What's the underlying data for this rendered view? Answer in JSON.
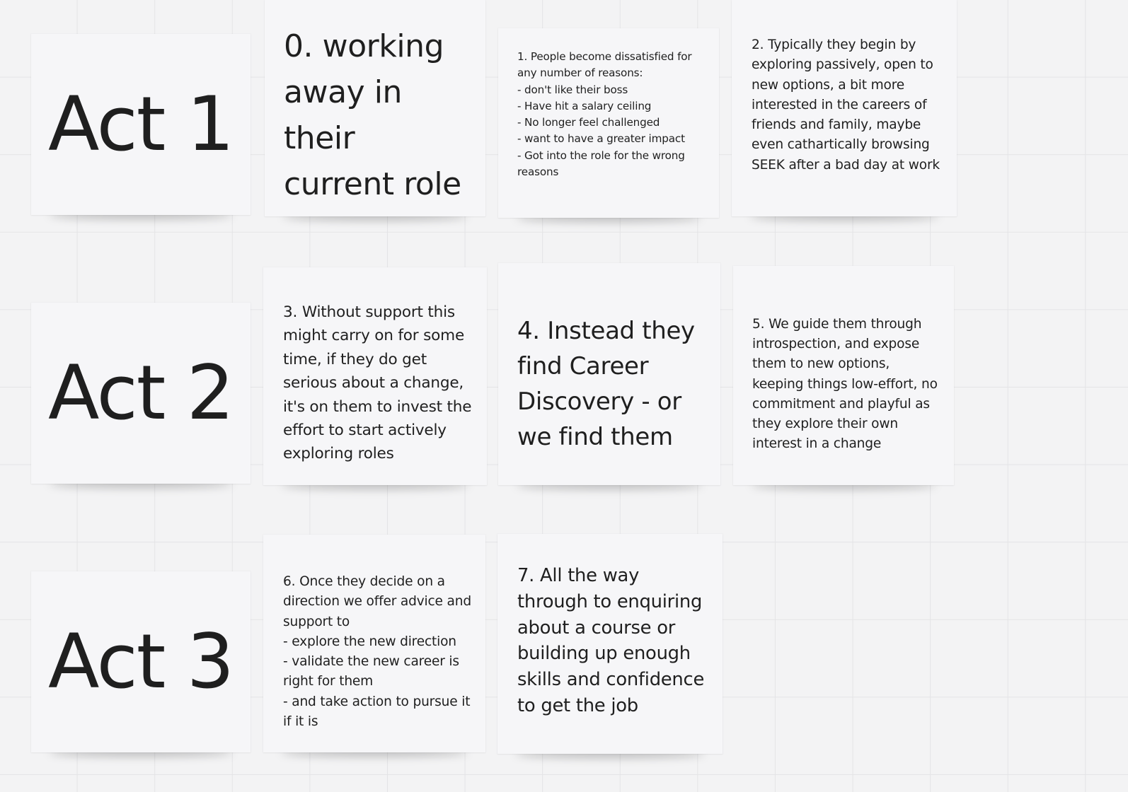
{
  "board": {
    "acts": [
      {
        "label": "Act 1"
      },
      {
        "label": "Act 2"
      },
      {
        "label": "Act 3"
      }
    ],
    "notes": [
      {
        "text": "0. working away in their current role"
      },
      {
        "text": "1. People become dissatisfied for any number of reasons:\n- don't like their boss\n- Have hit a salary ceiling\n- No longer feel challenged\n- want to have a greater impact\n- Got into the role for the wrong reasons"
      },
      {
        "text": "2. Typically they begin by exploring passively, open to new options, a bit more interested in the careers of friends and family, maybe even cathartically browsing SEEK after a bad day at work"
      },
      {
        "text": "3. Without support this might carry on for some time, if they do get serious about a change, it's on them to invest the effort to start actively exploring roles"
      },
      {
        "text": "4. Instead they find Career Discovery - or we find them"
      },
      {
        "text": "5. We guide them through introspection, and expose them to new options, keeping things low-effort, no commitment and playful as they explore their own interest in a change"
      },
      {
        "text": "6. Once they decide on a direction we offer advice and support to\n- explore the new direction\n- validate the new career is right for them\n- and take action to pursue it if it is"
      },
      {
        "text": "7. All the way through to enquiring about a course or building up enough skills and confidence to get the job"
      }
    ]
  },
  "colors": {
    "canvas": "#f3f3f4",
    "grid": "#e4e4e6",
    "note": "#f6f6f8",
    "text": "#1f1f1f"
  }
}
